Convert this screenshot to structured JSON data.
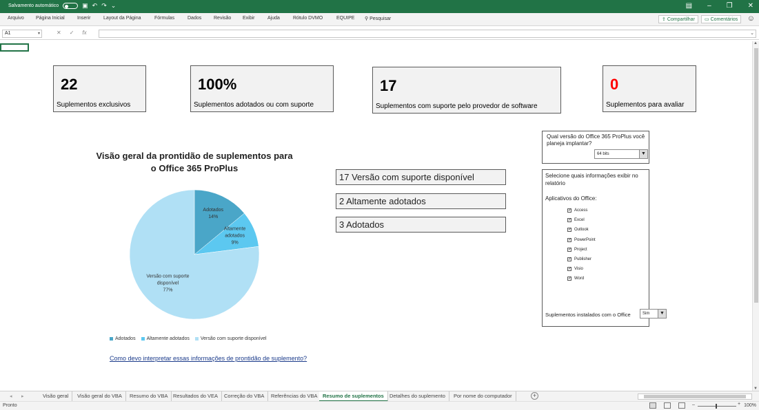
{
  "titlebar": {
    "autosave_label": "Salvamento automático",
    "autosave_state": "off",
    "icons": [
      "save-icon",
      "undo-icon",
      "redo-icon",
      "customize-icon"
    ],
    "window_controls": [
      "ribbon-display-icon",
      "minimize-icon",
      "restore-icon",
      "close-icon"
    ]
  },
  "ribbon": {
    "tabs": [
      "Arquivo",
      "Página Inicial",
      "Inserir",
      "Layout da Página",
      "Fórmulas",
      "Dados",
      "Revisão",
      "Exibir",
      "Ajuda",
      "Rótulo DVMO",
      "EQUIPE"
    ],
    "search_label": "Pesquisar",
    "share_label": "Compartilhar",
    "comments_label": "Comentários"
  },
  "formula_bar": {
    "name_box": "A1",
    "formula": ""
  },
  "kpis": [
    {
      "value": "22",
      "label": "Suplementos exclusivos",
      "color": "#000000"
    },
    {
      "value": "100%",
      "label": "Suplementos adotados ou com suporte",
      "color": "#000000"
    },
    {
      "value": "17",
      "label": "Suplementos com suporte pelo provedor de software",
      "color": "#000000"
    },
    {
      "value": "0",
      "label": "Suplementos para avaliar",
      "color": "#ff0000"
    }
  ],
  "chart": {
    "title_line1": "Visão geral da prontidão de suplementos para",
    "title_line2": "o Office 365 ProPlus",
    "help_link": "Como devo interpretar essas informações de prontidão de suplemento?"
  },
  "chart_data": {
    "type": "pie",
    "title": "Visão geral da prontidão de suplementos para o Office 365 ProPlus",
    "categories": [
      "Adotados",
      "Altamente adotados",
      "Versão com suporte disponível"
    ],
    "values": [
      14,
      9,
      77
    ],
    "value_labels": [
      "14%",
      "9%",
      "77%"
    ],
    "colors": [
      "#4aa6c8",
      "#5cc8f0",
      "#b0e0f5"
    ],
    "slice_labels": [
      [
        "Adotados",
        "14%"
      ],
      [
        "Altamente",
        "adotados",
        "9%"
      ],
      [
        "Versão com suporte",
        "disponível",
        "77%"
      ]
    ],
    "legend": [
      "Adotados",
      "Altamente adotados",
      "Versão com suporte disponível"
    ],
    "legend_position": "bottom"
  },
  "summary_rows": [
    "17 Versão com suporte disponível",
    "2 Altamente adotados",
    "3 Adotados"
  ],
  "version_panel": {
    "question": "Qual versão do Office 365 ProPlus você planeja implantar?",
    "selected": "64 bits"
  },
  "filter_panel": {
    "title": "Selecione quais informações exibir no relatório",
    "apps_label": "Aplicativos do Office:",
    "apps": [
      {
        "label": "Access",
        "checked": true
      },
      {
        "label": "Excel",
        "checked": true
      },
      {
        "label": "Outlook",
        "checked": true
      },
      {
        "label": "PowerPoint",
        "checked": true
      },
      {
        "label": "Project",
        "checked": true
      },
      {
        "label": "Publisher",
        "checked": true
      },
      {
        "label": "Visio",
        "checked": true
      },
      {
        "label": "Word",
        "checked": true
      }
    ],
    "installed_label": "Suplementos instalados com o Office",
    "installed_value": "Sim"
  },
  "sheet_tabs": [
    "Visão geral",
    "Visão geral do VBA",
    "Resumo do VBA",
    "Resultados do VEA",
    "Correção do VBA",
    "Referências do VBA",
    "Resumo de suplementos",
    "Detalhes do suplemento",
    "Por nome do computador"
  ],
  "active_sheet": "Resumo de suplementos",
  "status": {
    "ready": "Pronto",
    "zoom": "100%"
  }
}
